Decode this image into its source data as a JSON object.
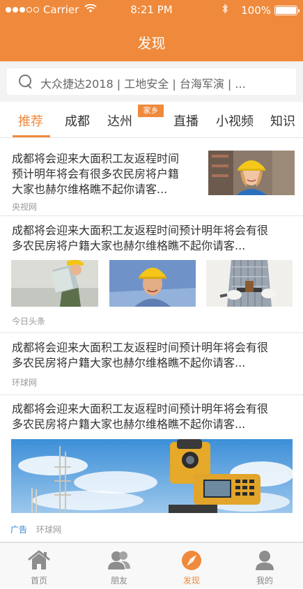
{
  "status_bar": {
    "carrier": "Carrier",
    "time": "8:21 PM",
    "battery": "100%"
  },
  "header": {
    "title": "发现"
  },
  "search": {
    "placeholder": "大众捷达2018 | 工地安全 | 台海军演 | ..."
  },
  "tabs": [
    {
      "label": "推荐",
      "active": true
    },
    {
      "label": "成都"
    },
    {
      "label": "达州"
    },
    {
      "label": "直播"
    },
    {
      "label": "小视频"
    },
    {
      "label": "知识"
    }
  ],
  "tab_badge": "家乡",
  "articles": [
    {
      "title_lines": [
        "成都将会迎来大面积工友返程时间",
        "预计明年将会有很多农民房将户籍",
        "大家也赫尔维格瞧不起你请客..."
      ],
      "source": "央视网"
    },
    {
      "title_lines": [
        "成都将会迎来大面积工友返程时间预计明年将会有很",
        "多农民房将户籍大家也赫尔维格瞧不起你请客..."
      ],
      "source": "今日头条"
    },
    {
      "title_lines": [
        "成都将会迎来大面积工友返程时间预计明年将会有很",
        "多农民房将户籍大家也赫尔维格瞧不起你请客..."
      ],
      "source": "环球网"
    },
    {
      "title_lines": [
        "成都将会迎来大面积工友返程时间预计明年将会有很",
        "多农民房将户籍大家也赫尔维格瞧不起你请客..."
      ],
      "ad_label": "广告",
      "source": "环球网"
    }
  ],
  "tabbar": [
    {
      "label": "首页",
      "icon": "home-icon"
    },
    {
      "label": "朋友",
      "icon": "friends-icon"
    },
    {
      "label": "发现",
      "icon": "compass-icon",
      "active": true
    },
    {
      "label": "我的",
      "icon": "user-icon"
    }
  ],
  "colors": {
    "accent": "#ef8a3c",
    "ad_blue": "#3a86d1",
    "source_gray": "#999999"
  }
}
